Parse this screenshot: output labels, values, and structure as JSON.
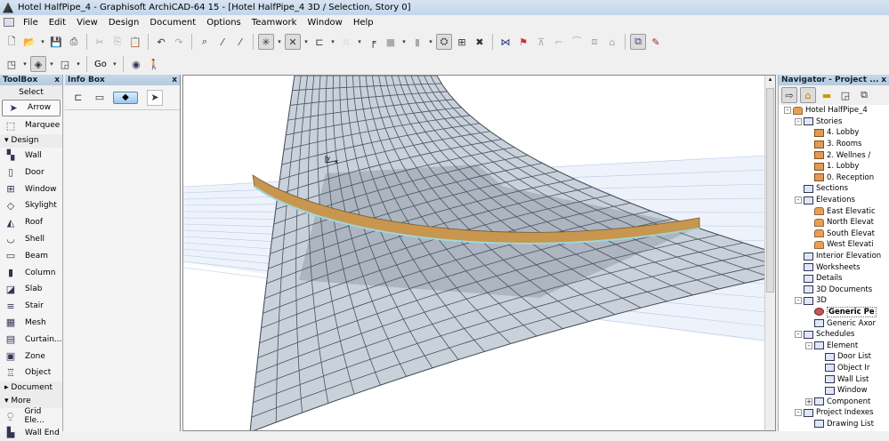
{
  "window": {
    "title": "Hotel HalfPipe_4 - Graphisoft ArchiCAD-64 15 - [Hotel HalfPipe_4 3D / Selection, Story 0]"
  },
  "menu": [
    "File",
    "Edit",
    "View",
    "Design",
    "Document",
    "Options",
    "Teamwork",
    "Window",
    "Help"
  ],
  "toolbar2": {
    "go_label": "Go"
  },
  "toolbox": {
    "title": "ToolBox",
    "close": "x",
    "select_header": "Select",
    "select_tools": [
      {
        "label": "Arrow",
        "icon": "arrow-icon"
      },
      {
        "label": "Marquee",
        "icon": "marquee-icon"
      }
    ],
    "design_header": "Design",
    "design_tools": [
      {
        "label": "Wall",
        "icon": "wall-icon"
      },
      {
        "label": "Door",
        "icon": "door-icon"
      },
      {
        "label": "Window",
        "icon": "window-icon"
      },
      {
        "label": "Skylight",
        "icon": "skylight-icon"
      },
      {
        "label": "Roof",
        "icon": "roof-icon"
      },
      {
        "label": "Shell",
        "icon": "shell-icon"
      },
      {
        "label": "Beam",
        "icon": "beam-icon"
      },
      {
        "label": "Column",
        "icon": "column-icon"
      },
      {
        "label": "Slab",
        "icon": "slab-icon"
      },
      {
        "label": "Stair",
        "icon": "stair-icon"
      },
      {
        "label": "Mesh",
        "icon": "mesh-icon"
      },
      {
        "label": "Curtain...",
        "icon": "curtain-wall-icon"
      },
      {
        "label": "Zone",
        "icon": "zone-icon"
      },
      {
        "label": "Object",
        "icon": "object-icon"
      }
    ],
    "document_header": "Document",
    "more_header": "More",
    "more_tools": [
      {
        "label": "Grid Ele...",
        "icon": "grid-element-icon"
      },
      {
        "label": "Wall End",
        "icon": "wall-end-icon"
      }
    ]
  },
  "infobox": {
    "title": "Info Box",
    "close": "x"
  },
  "viewport": {
    "axis_y": "y",
    "axis_x": "x",
    "slab_color": "#c8964f",
    "glass_color": "#8f9aa6"
  },
  "navigator": {
    "title": "Navigator - Project ...",
    "close": "x",
    "tree": [
      {
        "label": "Hotel HalfPipe_4",
        "level": 0,
        "toggle": "-",
        "icon": "project-icon"
      },
      {
        "label": "Stories",
        "level": 1,
        "toggle": "-",
        "icon": "stories-icon"
      },
      {
        "label": "4. Lobby",
        "level": 2,
        "icon": "story-icon"
      },
      {
        "label": "3. Rooms",
        "level": 2,
        "icon": "story-icon"
      },
      {
        "label": "2. Wellnes /",
        "level": 2,
        "icon": "story-icon"
      },
      {
        "label": "1. Lobby",
        "level": 2,
        "icon": "story-icon"
      },
      {
        "label": "0. Reception",
        "level": 2,
        "icon": "story-icon"
      },
      {
        "label": "Sections",
        "level": 1,
        "icon": "sections-icon"
      },
      {
        "label": "Elevations",
        "level": 1,
        "toggle": "-",
        "icon": "elevations-icon"
      },
      {
        "label": "East Elevatic",
        "level": 2,
        "icon": "elevation-icon"
      },
      {
        "label": "North Elevat",
        "level": 2,
        "icon": "elevation-icon"
      },
      {
        "label": "South Elevat",
        "level": 2,
        "icon": "elevation-icon"
      },
      {
        "label": "West Elevati",
        "level": 2,
        "icon": "elevation-icon"
      },
      {
        "label": "Interior Elevation",
        "level": 1,
        "icon": "interior-elevations-icon"
      },
      {
        "label": "Worksheets",
        "level": 1,
        "icon": "worksheets-icon"
      },
      {
        "label": "Details",
        "level": 1,
        "icon": "details-icon"
      },
      {
        "label": "3D Documents",
        "level": 1,
        "icon": "3d-documents-icon"
      },
      {
        "label": "3D",
        "level": 1,
        "toggle": "-",
        "icon": "3d-icon"
      },
      {
        "label": "Generic Pe",
        "level": 2,
        "icon": "camera-icon",
        "selected": true
      },
      {
        "label": "Generic Axor",
        "level": 2,
        "icon": "axonometry-icon"
      },
      {
        "label": "Schedules",
        "level": 1,
        "toggle": "-",
        "icon": "schedules-icon"
      },
      {
        "label": "Element",
        "level": 2,
        "toggle": "-",
        "icon": "element-schedule-icon"
      },
      {
        "label": "Door List",
        "level": 3,
        "icon": "list-icon"
      },
      {
        "label": "Object Ir",
        "level": 3,
        "icon": "list-icon"
      },
      {
        "label": "Wall List",
        "level": 3,
        "icon": "list-icon"
      },
      {
        "label": "Window",
        "level": 3,
        "icon": "list-icon"
      },
      {
        "label": "Component",
        "level": 2,
        "toggle": "+",
        "icon": "component-schedule-icon"
      },
      {
        "label": "Project Indexes",
        "level": 1,
        "toggle": "-",
        "icon": "project-indexes-icon"
      },
      {
        "label": "Drawing List",
        "level": 2,
        "icon": "drawing-list-icon"
      }
    ]
  }
}
